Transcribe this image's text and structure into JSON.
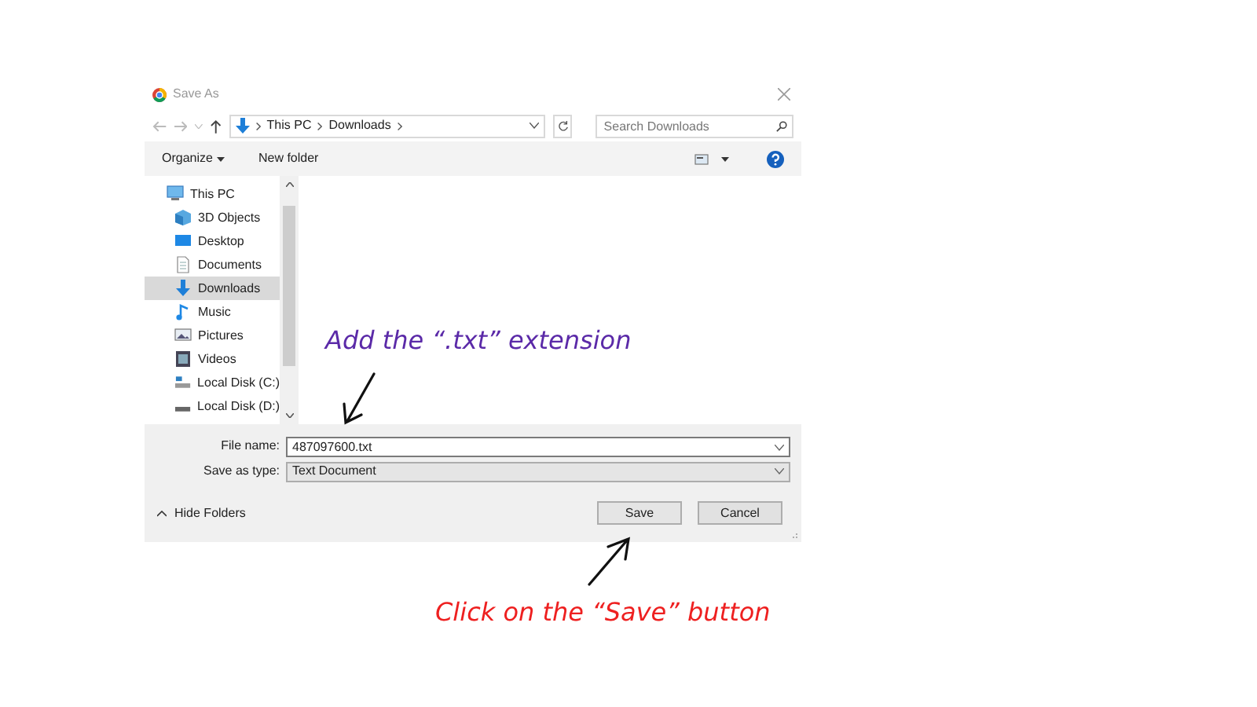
{
  "window": {
    "title": "Save As"
  },
  "address_bar": {
    "segments": [
      "This PC",
      "Downloads"
    ]
  },
  "search": {
    "placeholder": "Search Downloads"
  },
  "toolbar": {
    "organize": "Organize",
    "new_folder": "New folder"
  },
  "sidebar": {
    "items": [
      {
        "label": "This PC",
        "kind": "pc",
        "selected": false,
        "children": [
          {
            "label": "3D Objects",
            "kind": "objects",
            "selected": false
          },
          {
            "label": "Desktop",
            "kind": "desktop",
            "selected": false
          },
          {
            "label": "Documents",
            "kind": "documents",
            "selected": false
          },
          {
            "label": "Downloads",
            "kind": "downloads",
            "selected": true
          },
          {
            "label": "Music",
            "kind": "music",
            "selected": false
          },
          {
            "label": "Pictures",
            "kind": "pictures",
            "selected": false
          },
          {
            "label": "Videos",
            "kind": "videos",
            "selected": false
          },
          {
            "label": "Local Disk (C:)",
            "kind": "disk_c",
            "selected": false
          },
          {
            "label": "Local Disk (D:)",
            "kind": "disk",
            "selected": false
          }
        ]
      }
    ]
  },
  "form": {
    "file_name_label": "File name:",
    "file_name": "487097600.txt",
    "type_label": "Save as type:",
    "type": "Text Document"
  },
  "hide_folders": "Hide Folders",
  "buttons": [
    "Save",
    "Cancel"
  ],
  "annotations": [
    {
      "text": "Add the “.txt” extension",
      "color": "#5b2aa8"
    },
    {
      "text": "Click on the “Save” button",
      "color": "#ee2020"
    }
  ]
}
